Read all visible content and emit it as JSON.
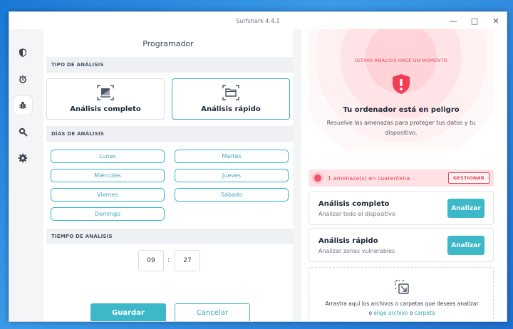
{
  "window": {
    "title": "Surfshark 4.4.1"
  },
  "left": {
    "title": "Programador",
    "scan_type": {
      "header": "TIPO DE ANÁLISIS",
      "full_label": "Análisis completo",
      "quick_label": "Análisis rápido",
      "selected": "quick"
    },
    "days": {
      "header": "DÍAS DE ANÁLISIS",
      "items": [
        "Lunes",
        "Martes",
        "Miércoles",
        "Jueves",
        "Viernes",
        "Sábado",
        "Domingo"
      ]
    },
    "time": {
      "header": "TIEMPO DE ANÁLISIS",
      "hour": "09",
      "separator": ":",
      "minute": "27"
    },
    "save_label": "Guardar",
    "cancel_label": "Cancelar"
  },
  "right": {
    "last_scan": "ÚLTIMO ANÁLISIS HACE UN MOMENTO",
    "danger_title": "Tu ordenador está en peligro",
    "danger_sub": "Resuelve las amenazas para proteger tus datos y tu dispositivo.",
    "quarantine_text": "1 amenaza(s) en cuarentena",
    "manage_label": "GESTIONAR",
    "full_scan": {
      "title": "Análisis completo",
      "sub": "Analizar todo el dispositivo",
      "button": "Analizar"
    },
    "quick_scan": {
      "title": "Análisis rápido",
      "sub": "Analizar zonas vulnerables",
      "button": "Analizar"
    },
    "drop": {
      "line1": "Arrastra aquí los archivos o carpetas que desees analizar",
      "prefix": "o",
      "choose_file": "elige archivo",
      "middle": "o",
      "folder": "carpeta"
    }
  },
  "colors": {
    "accent": "#3cb8c8",
    "danger": "#e24a5b"
  },
  "icons": {
    "sidebar": [
      "shield-icon",
      "alert-bug-icon",
      "antivirus-bug-icon",
      "search-virus-icon",
      "gear-icon"
    ]
  }
}
